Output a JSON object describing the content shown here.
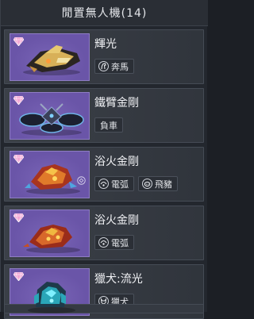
{
  "header": {
    "title": "閒置無人機(14)"
  },
  "drones": [
    {
      "name": "輝光",
      "traits": [
        {
          "icon": "horse-icon",
          "label": "奔馬"
        }
      ]
    },
    {
      "name": "鐵臂金剛",
      "traits": [
        {
          "icon": "",
          "label": "負車"
        }
      ]
    },
    {
      "name": "浴火金剛",
      "traits": [
        {
          "icon": "arc-icon",
          "label": "電弧"
        },
        {
          "icon": "boar-icon",
          "label": "飛豬"
        }
      ]
    },
    {
      "name": "浴火金剛",
      "traits": [
        {
          "icon": "arc-icon",
          "label": "電弧"
        }
      ]
    },
    {
      "name": "獵犬:流光",
      "traits": [
        {
          "icon": "dog-icon",
          "label": "獵犬"
        }
      ]
    }
  ],
  "colors": {
    "thumb_background": "#6a55a8",
    "rarity_gem": "#f3a8d6",
    "panel": "#23272e"
  }
}
